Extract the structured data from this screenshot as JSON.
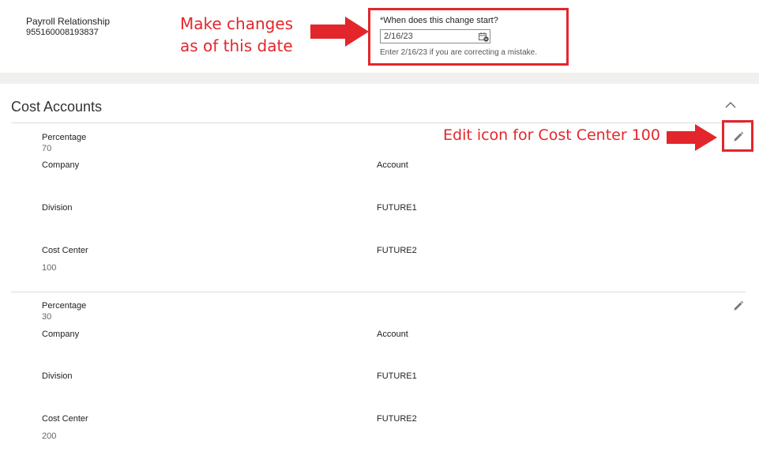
{
  "header": {
    "payroll_relationship_label": "Payroll Relationship",
    "payroll_relationship_number": "955160008193837",
    "effective_date": {
      "required_marker": "*",
      "label": "When does this change start?",
      "value": "2/16/23",
      "hint": "Enter 2/16/23 if you are correcting a mistake."
    }
  },
  "annotations": {
    "date_note_line1": "Make changes",
    "date_note_line2": "as of this date",
    "edit_note": "Edit icon for Cost Center 100",
    "color": "#e3262b"
  },
  "cost_accounts": {
    "title": "Cost Accounts",
    "rows": [
      {
        "percentage_label": "Percentage",
        "percentage_value": "70",
        "company_label": "Company",
        "account_label": "Account",
        "division_label": "Division",
        "future1_label": "FUTURE1",
        "cost_center_label": "Cost Center",
        "cost_center_value": "100",
        "future2_label": "FUTURE2"
      },
      {
        "percentage_label": "Percentage",
        "percentage_value": "30",
        "company_label": "Company",
        "account_label": "Account",
        "division_label": "Division",
        "future1_label": "FUTURE1",
        "cost_center_label": "Cost Center",
        "cost_center_value": "200",
        "future2_label": "FUTURE2"
      }
    ]
  },
  "icons": [
    "calendar-icon",
    "collapse-chevron-icon",
    "edit-pencil-icon",
    "arrow-icon"
  ]
}
